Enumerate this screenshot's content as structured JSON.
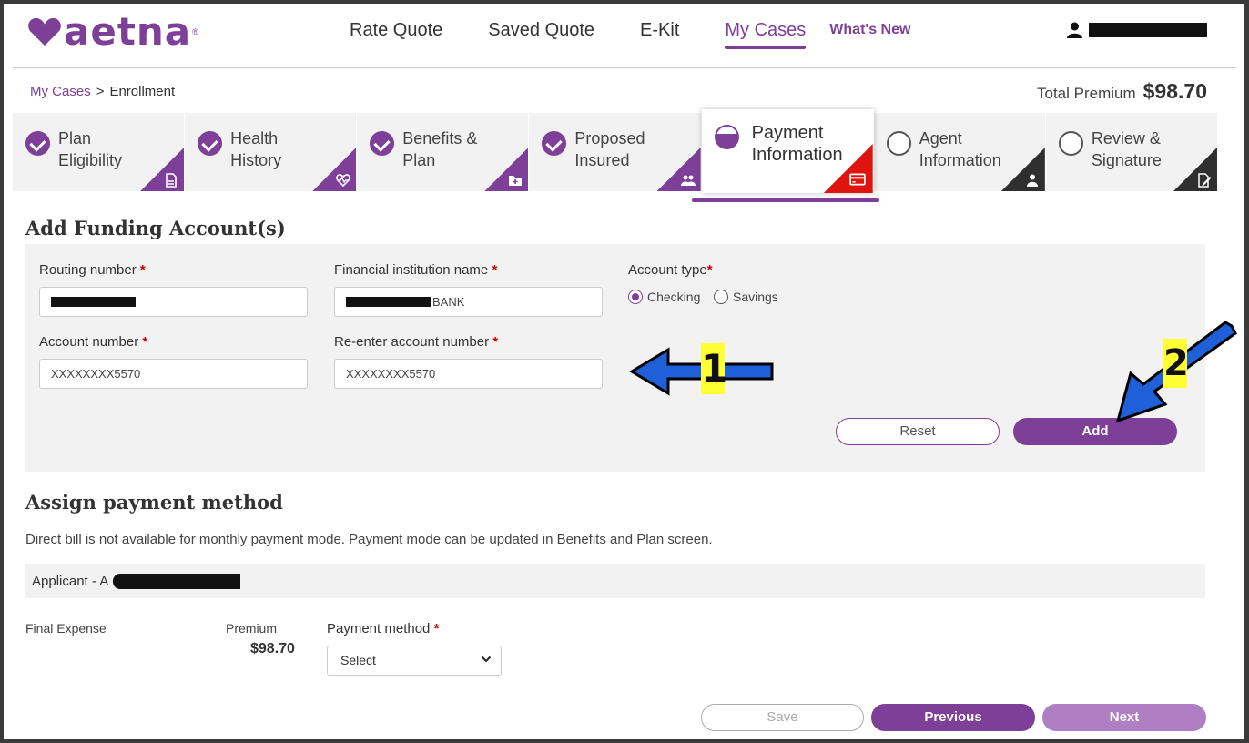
{
  "brand": {
    "logo_text": "aetna",
    "logo_mark": "heart-icon",
    "accent": "#7d3f98"
  },
  "nav": {
    "items": [
      "Rate Quote",
      "Saved Quote",
      "E-Kit",
      "My Cases"
    ],
    "active": "My Cases",
    "whats_new": "What's New"
  },
  "breadcrumb": {
    "root": "My Cases",
    "separator": ">",
    "current": "Enrollment"
  },
  "total_premium": {
    "label": "Total Premium",
    "value": "$98.70"
  },
  "steps": [
    {
      "label": "Plan\nEligibility",
      "status": "done",
      "icon": "document-icon"
    },
    {
      "label": "Health\nHistory",
      "status": "done",
      "icon": "heart-pulse-icon"
    },
    {
      "label": "Benefits &\nPlan",
      "status": "done",
      "icon": "folder-plus-icon"
    },
    {
      "label": "Proposed\nInsured",
      "status": "done",
      "icon": "people-icon"
    },
    {
      "label": "Payment\nInformation",
      "status": "current",
      "icon": "credit-card-icon"
    },
    {
      "label": "Agent\nInformation",
      "status": "pending",
      "icon": "person-icon"
    },
    {
      "label": "Review &\nSignature",
      "status": "pending",
      "icon": "edit-document-icon"
    }
  ],
  "funding": {
    "title": "Add Funding Account(s)",
    "routing_label": "Routing number",
    "institution_label": "Financial institution name",
    "institution_value": "BANK",
    "account_type_label": "Account type",
    "account_types": [
      "Checking",
      "Savings"
    ],
    "account_type_selected": "Checking",
    "account_label": "Account number",
    "account_value": "XXXXXXXX5570",
    "reenter_label": "Re-enter account number",
    "reenter_value": "XXXXXXXX5570",
    "required_mark": "*",
    "reset_label": "Reset",
    "add_label": "Add"
  },
  "assign": {
    "title": "Assign payment method",
    "note": "Direct bill is not available for monthly payment mode. Payment mode can be updated in Benefits and Plan screen.",
    "applicant_prefix": "Applicant - A",
    "product": "Final Expense",
    "premium_label": "Premium",
    "premium_value": "$98.70",
    "payment_method_label": "Payment method",
    "payment_method_value": "Select"
  },
  "footer": {
    "save_label": "Save",
    "previous_label": "Previous",
    "next_label": "Next"
  },
  "annotations": {
    "arrow_1_label": "1",
    "arrow_2_label": "2",
    "arrow_color": "#1f5fd8"
  }
}
